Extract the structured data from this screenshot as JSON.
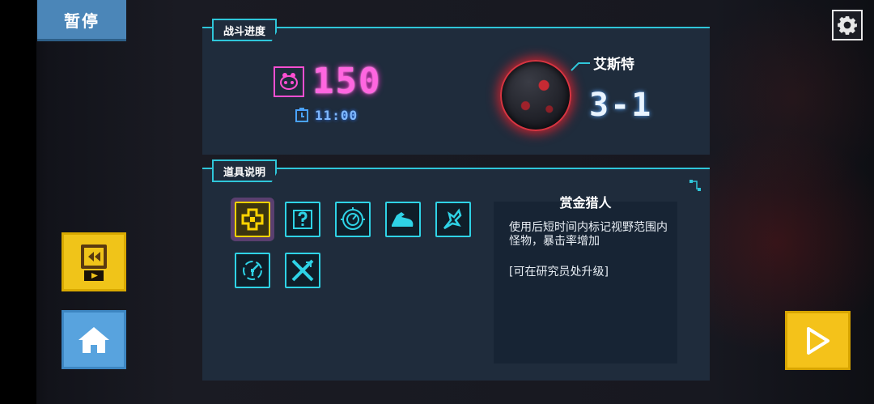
{
  "header": {
    "pause_label": "暂停"
  },
  "battle_progress": {
    "title": "战斗进度",
    "score": "150",
    "time": "11:00",
    "level_name": "艾斯特",
    "level_number": "3-1"
  },
  "item_info": {
    "title": "道具说明",
    "items": [
      {
        "icon": "bounty-hunter-icon",
        "selected": true
      },
      {
        "icon": "question-mark-icon",
        "selected": false
      },
      {
        "icon": "radar-icon",
        "selected": false
      },
      {
        "icon": "strength-arm-icon",
        "selected": false
      },
      {
        "icon": "claw-hand-icon",
        "selected": false
      },
      {
        "icon": "clock-speed-icon",
        "selected": false
      },
      {
        "icon": "crossed-swords-icon",
        "selected": false
      }
    ],
    "description": {
      "name": "赏金猎人",
      "text": "使用后短时间内标记视野范围内怪物，暴击率增加",
      "upgrade_note": "[可在研究员处升级]"
    }
  },
  "colors": {
    "accent": "#2fc6d9",
    "score": "#ff66e0",
    "selected": "#ffd400",
    "button_yellow": "#f4c21a",
    "button_blue": "#58a3de"
  }
}
